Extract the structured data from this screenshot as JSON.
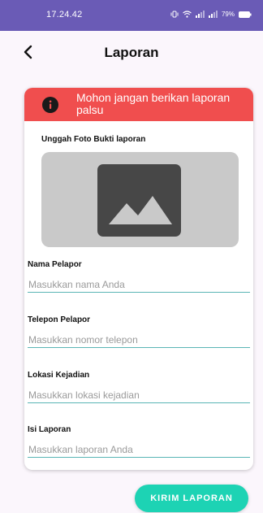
{
  "status_bar": {
    "time": "17.24.42",
    "battery": "79%",
    "icons": [
      "vibrate-icon",
      "wifi-icon",
      "signal-icon",
      "signal-icon",
      "battery-icon"
    ]
  },
  "app_bar": {
    "title": "Laporan",
    "back_icon": "chevron-left-icon"
  },
  "form": {
    "warning": {
      "text": "Mohon jangan berikan laporan palsu",
      "icon": "alert-circle-icon",
      "color": "#f04e4e"
    },
    "upload": {
      "label": "Unggah Foto Bukti laporan",
      "icon": "image-placeholder-icon"
    },
    "fields": [
      {
        "label": "Nama Pelapor",
        "placeholder": "Masukkan nama Anda",
        "value": ""
      },
      {
        "label": "Telepon Pelapor",
        "placeholder": "Masukkan nomor telepon",
        "value": ""
      },
      {
        "label": "Lokasi Kejadian",
        "placeholder": "Masukkan lokasi kejadian",
        "value": ""
      },
      {
        "label": "Isi Laporan",
        "placeholder": "Masukkan laporan Anda",
        "value": ""
      }
    ],
    "submit_label": "KIRIM LAPORAN"
  },
  "colors": {
    "status_bar": "#6a5bb6",
    "background": "#fbf6fc",
    "accent": "#1dd3b4",
    "input_underline": "#5ab5b5"
  }
}
